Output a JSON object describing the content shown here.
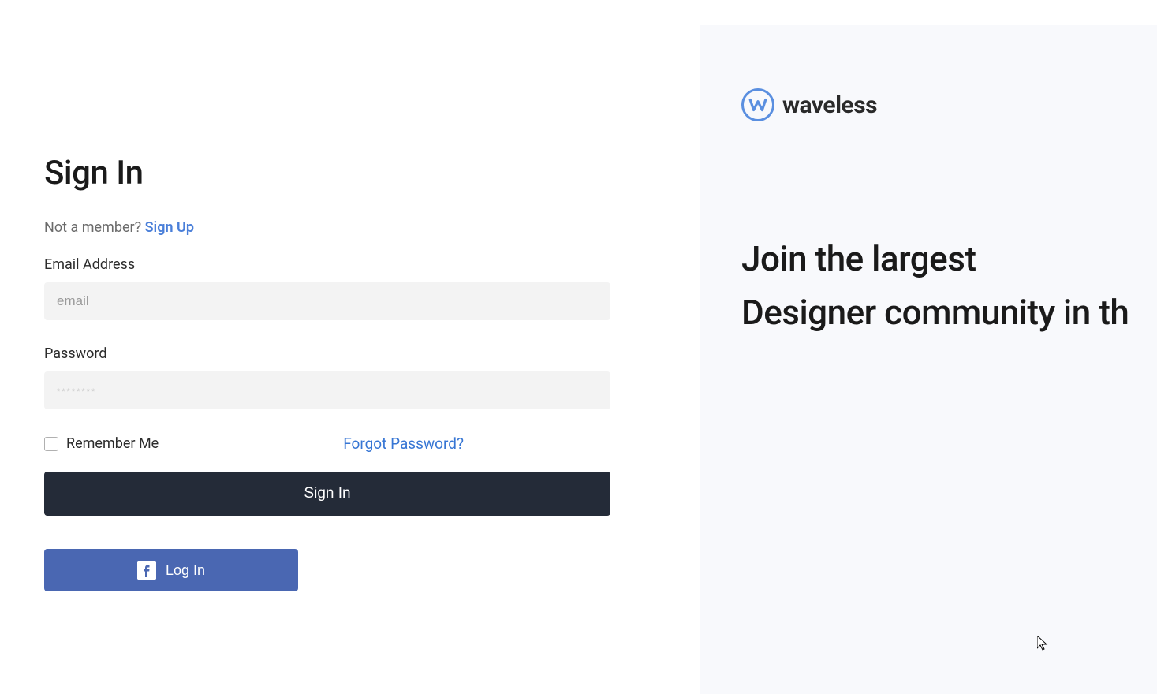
{
  "form": {
    "title": "Sign In",
    "not_member_text": "Not a member? ",
    "signup_label": "Sign Up",
    "email_label": "Email Address",
    "email_placeholder": "email",
    "password_label": "Password",
    "password_placeholder": "********",
    "remember_label": "Remember Me",
    "forgot_label": "Forgot Password?",
    "signin_button": "Sign In",
    "fb_button": "Log In"
  },
  "brand": {
    "name": "waveless"
  },
  "hero": {
    "line1": "Join the largest",
    "line2": "Designer community in th"
  },
  "colors": {
    "link": "#4a7fd9",
    "dark_button": "#242b38",
    "fb_button": "#4a67b2",
    "right_bg": "#f8f9fc",
    "logo": "#5a8fe0"
  }
}
